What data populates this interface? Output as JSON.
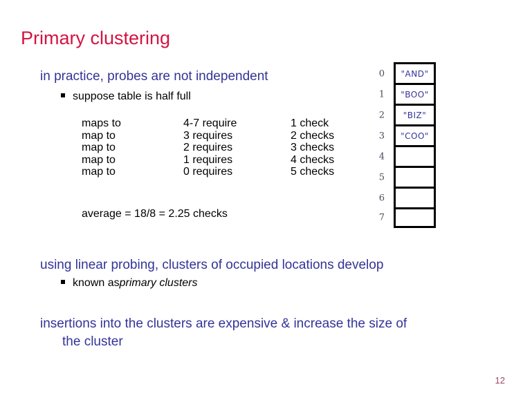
{
  "slide": {
    "title": "Primary clustering",
    "page_number": "12",
    "title_color": "#d41341",
    "body_color": "#333399",
    "detail_color": "#000000",
    "page_number_color": "#9b4a5e"
  },
  "intro": {
    "line1": "in practice, probes are not independent",
    "bullet1": "suppose table is half full"
  },
  "probe_table": {
    "rows": [
      {
        "maps": "maps to",
        "requires": "4-7 require",
        "checks": "1 check"
      },
      {
        "maps": "map to",
        "requires": "3 requires",
        "checks": "2 checks"
      },
      {
        "maps": "map to",
        "requires": "2 requires",
        "checks": "3 checks"
      },
      {
        "maps": "map to",
        "requires": "1 requires",
        "checks": "4 checks"
      },
      {
        "maps": "map to",
        "requires": "0 requires",
        "checks": "5 checks"
      }
    ],
    "average": "average = 18/8 = 2.25 checks"
  },
  "hash_table": {
    "cells": [
      {
        "index": "0",
        "value": "\"AND\""
      },
      {
        "index": "1",
        "value": "\"BOO\""
      },
      {
        "index": "2",
        "value": "\"BIZ\""
      },
      {
        "index": "3",
        "value": "\"COO\""
      },
      {
        "index": "4",
        "value": ""
      },
      {
        "index": "5",
        "value": ""
      },
      {
        "index": "6",
        "value": ""
      },
      {
        "index": "7",
        "value": ""
      }
    ]
  },
  "conclusions": {
    "line_linear_probing": "using linear probing, clusters of occupied locations develop",
    "bullet_known_as_prefix": "known as ",
    "bullet_known_as_italic": "primary clusters",
    "line_insertions_part1": "insertions into the clusters are expensive & increase the size of",
    "line_insertions_part2": "the cluster"
  }
}
